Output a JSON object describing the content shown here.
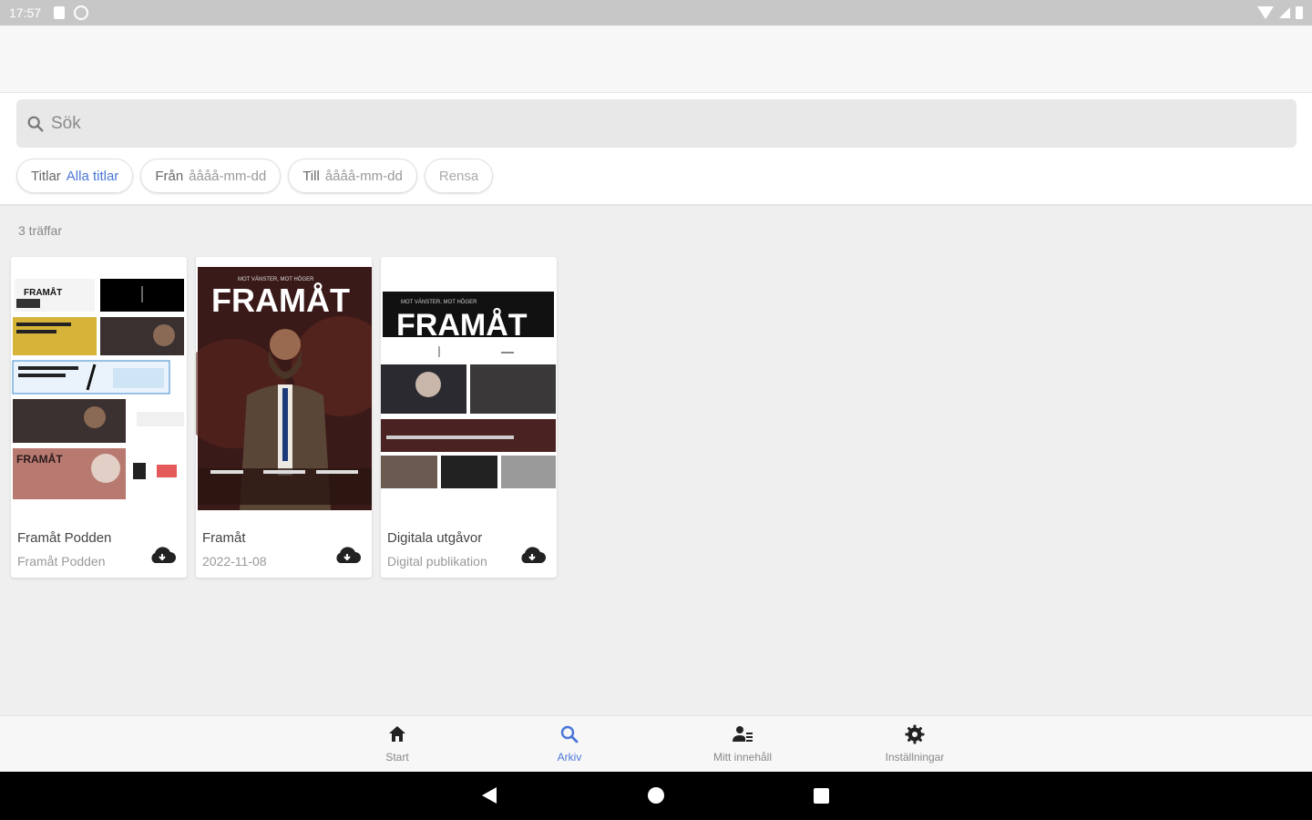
{
  "status_bar": {
    "time": "17:57"
  },
  "search": {
    "placeholder": "Sök"
  },
  "filters": {
    "titles_label": "Titlar",
    "titles_value": "Alla titlar",
    "from_label": "Från",
    "from_value": "åååå-mm-dd",
    "to_label": "Till",
    "to_value": "åååå-mm-dd",
    "clear_label": "Rensa"
  },
  "results": {
    "count_text": "3 träffar",
    "items": [
      {
        "title": "Framåt Podden",
        "subtitle": "Framåt Podden",
        "cover_text": "FRAMÅT"
      },
      {
        "title": "Framåt",
        "subtitle": "2022-11-08",
        "cover_text": "FRAMÅT",
        "cover_tagline": "MOT VÄNSTER, MOT HÖGER"
      },
      {
        "title": "Digitala utgåvor",
        "subtitle": "Digital publikation",
        "cover_text": "FRAMÅT",
        "cover_tagline": "MOT VÄNSTER, MOT HÖGER"
      }
    ]
  },
  "bottom_nav": {
    "items": [
      {
        "label": "Start",
        "icon": "home-icon"
      },
      {
        "label": "Arkiv",
        "icon": "search-icon"
      },
      {
        "label": "Mitt innehåll",
        "icon": "person-list-icon"
      },
      {
        "label": "Inställningar",
        "icon": "gear-icon"
      }
    ],
    "active": "Arkiv",
    "active_color": "#4a76d8"
  }
}
